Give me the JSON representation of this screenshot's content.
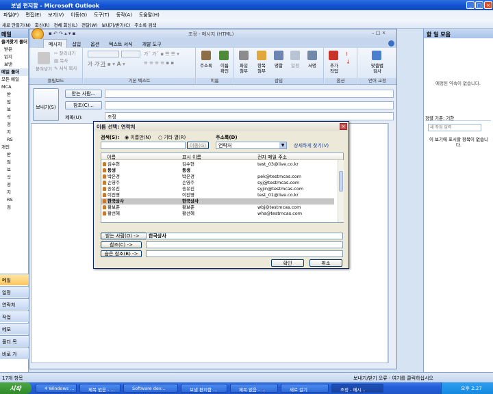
{
  "outlook": {
    "title": "보낼 편지함 - Microsoft Outlook",
    "menu": [
      "파일(F)",
      "편집(E)",
      "보기(V)",
      "이동(G)",
      "도구(T)",
      "동작(A)",
      "도움말(H)"
    ],
    "toolbar": [
      "새로 만들기(N)",
      "회신(R)",
      "전체 회신(L)",
      "전달(W)",
      "보내기/받기(C)",
      "주소록 검색"
    ],
    "nav_title": "메일",
    "nav_favorites": "즐겨찾기 폴더",
    "nav_fav_items": [
      "받은",
      "읽지",
      "보낸"
    ],
    "nav_folders_title": "메일 폴더",
    "nav_all_items": "모든 메일",
    "nav_folder_items": [
      "MCA",
      "받",
      "임",
      "보",
      "삭",
      "정",
      "지",
      "RS",
      "개인",
      "받",
      "임",
      "보",
      "삭",
      "정",
      "지",
      "RS",
      "검"
    ],
    "nav_buttons": [
      "메일",
      "일정",
      "연락처",
      "작업",
      "메모",
      "폴더 목",
      "바로 가"
    ],
    "todo_title": "할 일 모음",
    "todo_no_appointments": "예정된 약속이 없습니다.",
    "todo_sort_label": "정렬 기준: 기한",
    "todo_new_task_placeholder": "새 작업 입력",
    "todo_empty": "이 보기에 표시할 항목이 없습니다.",
    "status_items": "17개 항목",
    "status_error": "보내기/받기 오류 - 여기를 클릭하십시오"
  },
  "message": {
    "title": "조정 - 메시지 (HTML)",
    "tabs": [
      "메시지",
      "삽입",
      "옵션",
      "텍스트 서식",
      "개발 도구"
    ],
    "groups": {
      "clipboard": "클립보드",
      "basic_text": "기본 텍스트",
      "names": "이름",
      "include": "삽입",
      "options": "옵션",
      "proofing": "언어 교정"
    },
    "ribbon_buttons": {
      "paste": "붙여넣기",
      "cut": "잘라내기",
      "copy": "복사",
      "format_painter": "서식 복사",
      "address_book": "주소록",
      "check_names": "이름\n확인",
      "attach_file": "파일\n첨부",
      "attach_item": "항목\n첨부",
      "business_card": "명함",
      "calendar": "일정",
      "signature": "서명",
      "follow_up": "추가\n작업",
      "spelling": "맞춤법\n검사"
    },
    "send": "보내기(S)",
    "to_button": "받는 사람...",
    "cc_button": "참조(C)...",
    "subject_label": "제목(U):",
    "subject_value": "조정"
  },
  "dialog": {
    "title": "이름 선택: 연락처",
    "search_label": "검색(S):",
    "radio_name_only": "이름만(N)",
    "radio_more_columns": "기타 열(R)",
    "address_book_label": "주소록(D)",
    "address_book_value": "연락처",
    "go_button": "이동(G)",
    "advanced_find": "상세하게 찾기(V)",
    "columns": [
      "이름",
      "표시 이름",
      "전자 메일 주소"
    ],
    "rows": [
      {
        "name": "김수현",
        "display": "김수현",
        "email": "test_03@live.co.kr",
        "bold": false,
        "selected": false
      },
      {
        "name": "동생",
        "display": "동생",
        "email": "",
        "bold": true,
        "selected": false
      },
      {
        "name": "박은경",
        "display": "박은경",
        "email": "pek@testmcas.com",
        "bold": false,
        "selected": false
      },
      {
        "name": "손영주",
        "display": "손영주",
        "email": "syj@testmcas.com",
        "bold": false,
        "selected": false
      },
      {
        "name": "송유진",
        "display": "송유진",
        "email": "syjin@testmcas.com",
        "bold": false,
        "selected": false
      },
      {
        "name": "이진영",
        "display": "이진영",
        "email": "test_01@live.co.kr",
        "bold": false,
        "selected": false
      },
      {
        "name": "한국상사",
        "display": "한국상사",
        "email": "",
        "bold": true,
        "selected": true
      },
      {
        "name": "황보준",
        "display": "황보준",
        "email": "wbj@testmcas.com",
        "bold": false,
        "selected": false
      },
      {
        "name": "황선혜",
        "display": "황선혜",
        "email": "whs@testmcas.com",
        "bold": false,
        "selected": false
      }
    ],
    "to_button": "받는 사람(O) ->",
    "to_value": "한국상사",
    "cc_button": "참조(C) ->",
    "bcc_button": "숨은 참조(B) ->",
    "ok": "확인",
    "cancel": "취소"
  },
  "taskbar": {
    "start": "시작",
    "tasks": [
      "4 Windows ...",
      "제목 없음 - ...",
      "Software dev...",
      "보낼 편지함 ...",
      "제목 없음 - ...",
      "새로 걸기",
      "조정 - 메시..."
    ],
    "clock": "오후 2:27"
  }
}
